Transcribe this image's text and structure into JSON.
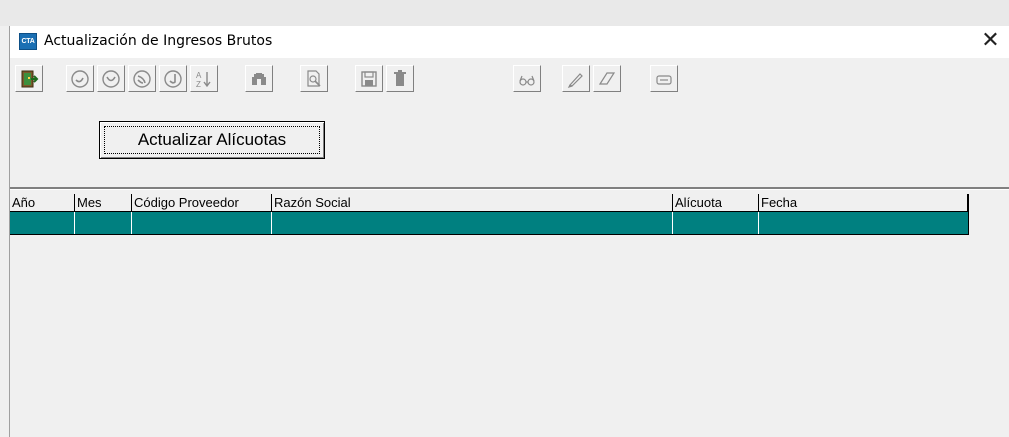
{
  "window": {
    "app_icon_text": "CTA",
    "title": "Actualización de Ingresos Brutos",
    "close_label": "✕"
  },
  "toolbar": {
    "buttons": [
      {
        "name": "exit-icon"
      },
      {
        "name": "first-record-icon"
      },
      {
        "name": "previous-record-icon"
      },
      {
        "name": "next-record-icon"
      },
      {
        "name": "last-record-icon"
      },
      {
        "name": "sort-icon"
      },
      {
        "name": "find-icon"
      },
      {
        "name": "preview-icon"
      },
      {
        "name": "save-icon"
      },
      {
        "name": "delete-icon"
      },
      {
        "name": "view-icon"
      },
      {
        "name": "edit-icon"
      },
      {
        "name": "erase-icon"
      },
      {
        "name": "print-icon"
      }
    ]
  },
  "actions": {
    "update_rates_label": "Actualizar Alícuotas"
  },
  "grid": {
    "columns": [
      "Año",
      "Mes",
      "Código Proveedor",
      "Razón Social",
      "Alícuota",
      "Fecha"
    ],
    "rows": [
      {
        "year": "",
        "month": "",
        "supplier_code": "",
        "business_name": "",
        "rate": "",
        "date": ""
      }
    ],
    "selected_row_color": "#008080"
  }
}
